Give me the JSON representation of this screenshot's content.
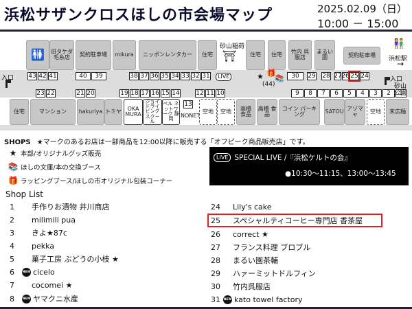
{
  "header": {
    "title": "浜松サザンクロスほしの市会場マップ",
    "date": "2025.02.09（日）",
    "time": "10:00 － 15:00"
  },
  "map": {
    "top_blocks": {
      "old_kimono": "旧タケダ 毛糸店",
      "contract_parking_left": "契約駐車場",
      "mikura": "mikura",
      "nikken_rental": "ニッポンレンタカー",
      "house1": "住宅",
      "shrine": "砂山稲荷",
      "house2": "住宅",
      "house3": "住宅",
      "takeuchi": "竹内 呉服店",
      "marui": "まるい 園",
      "contract_parking_right": "契約駐車場",
      "hamamatsu_station": "浜松駅"
    },
    "bottom_blocks": {
      "house_a": "住宅",
      "mansion": "マンション",
      "hakuriya": "hakuriya",
      "tomiya": "トミヤ",
      "okamura": "OKA MURA",
      "joy_driving": "ジョイ ドライビング スクール",
      "bell_network": "ベル ネットワーク 静岡",
      "nonet_num": "13",
      "nonet": "NONET",
      "vacant1": "空地",
      "vacant2": "空地",
      "highrise1": "高橋 食品",
      "highrise2": "高橋 食品",
      "coin_parking": "コイン パーキング",
      "satou": "SATOU",
      "apparel": "アゾマャ",
      "vacant3": "空地",
      "sueshiro": "末広麺",
      "sunayama_park": "砂山 公園"
    },
    "top_row_nums": [
      "43",
      "42",
      "41",
      "40",
      "39",
      "38",
      "37",
      "36",
      "35",
      "34",
      "33",
      "32",
      "31"
    ],
    "live_label": "LIVE",
    "top_right_nums": [
      "30",
      "29",
      "28",
      "27",
      "26",
      "25",
      "24"
    ],
    "count_44": "(44)",
    "mid_left_nums": [
      "23",
      "22",
      "21",
      "20"
    ],
    "mid_nums": [
      "19",
      "18",
      "17",
      "16",
      "15",
      "14",
      "12",
      "11",
      "10"
    ],
    "mid_right_nums": [
      "9",
      "8",
      "7",
      "6",
      "5",
      "4",
      "3",
      "2",
      "1"
    ],
    "entrance": "入口"
  },
  "shops_header": {
    "label": "SHOPS",
    "note": "★マークのあるお店は一部商品を12:00以降に販売する「オフピーク商品販売店」です。"
  },
  "legend": [
    {
      "icon": "star-icon",
      "glyph": "★",
      "text": "本部/オリジナルグッズ販売"
    },
    {
      "icon": "book-icon",
      "glyph": "📚",
      "text": "ほしの文庫/本の交換ブース"
    },
    {
      "icon": "gift-icon",
      "glyph": "🎁",
      "text": "ラッピングブース/ほしの市オリジナル包装コーナー"
    }
  ],
  "live_box": {
    "pill": "LIVE",
    "title": "SPECIAL LIVE /『浜松ケルトの会』",
    "times": "●10:30～11:15、13:00～13:45"
  },
  "shop_list_label": "Shop List",
  "shops_left": [
    {
      "num": "1",
      "name": "手作りお漬物 井川商店",
      "new": false
    },
    {
      "num": "2",
      "name": "milimili pua",
      "new": false
    },
    {
      "num": "3",
      "name": "きよ★87c",
      "new": false
    },
    {
      "num": "4",
      "name": "pekka",
      "new": false
    },
    {
      "num": "5",
      "name": "菓子工房 ぶどうの小枝 ★",
      "new": false
    },
    {
      "num": "6",
      "name": "cicelo",
      "new": true
    },
    {
      "num": "7",
      "name": "cocomei ★",
      "new": false
    },
    {
      "num": "8",
      "name": "ヤマクニ水産",
      "new": true
    }
  ],
  "shops_right": [
    {
      "num": "24",
      "name": "Lily's cake",
      "new": false
    },
    {
      "num": "25",
      "name": "スペシャルティコーヒー専門店 香茶屋",
      "new": false
    },
    {
      "num": "26",
      "name": "correct ★",
      "new": false
    },
    {
      "num": "27",
      "name": "フランス料理 ブロブル",
      "new": false
    },
    {
      "num": "28",
      "name": "まるい園茶輔",
      "new": false
    },
    {
      "num": "29",
      "name": "ハァーミットドルフィン",
      "new": false
    },
    {
      "num": "30",
      "name": "竹内呉服店",
      "new": false
    },
    {
      "num": "31",
      "name": "kato towel factory",
      "new": true
    }
  ],
  "new_badge": "NEW",
  "colors": {
    "highlight": "#e02020",
    "navy_rule": "#1b2040",
    "block_gray": "#c7c7c7"
  }
}
